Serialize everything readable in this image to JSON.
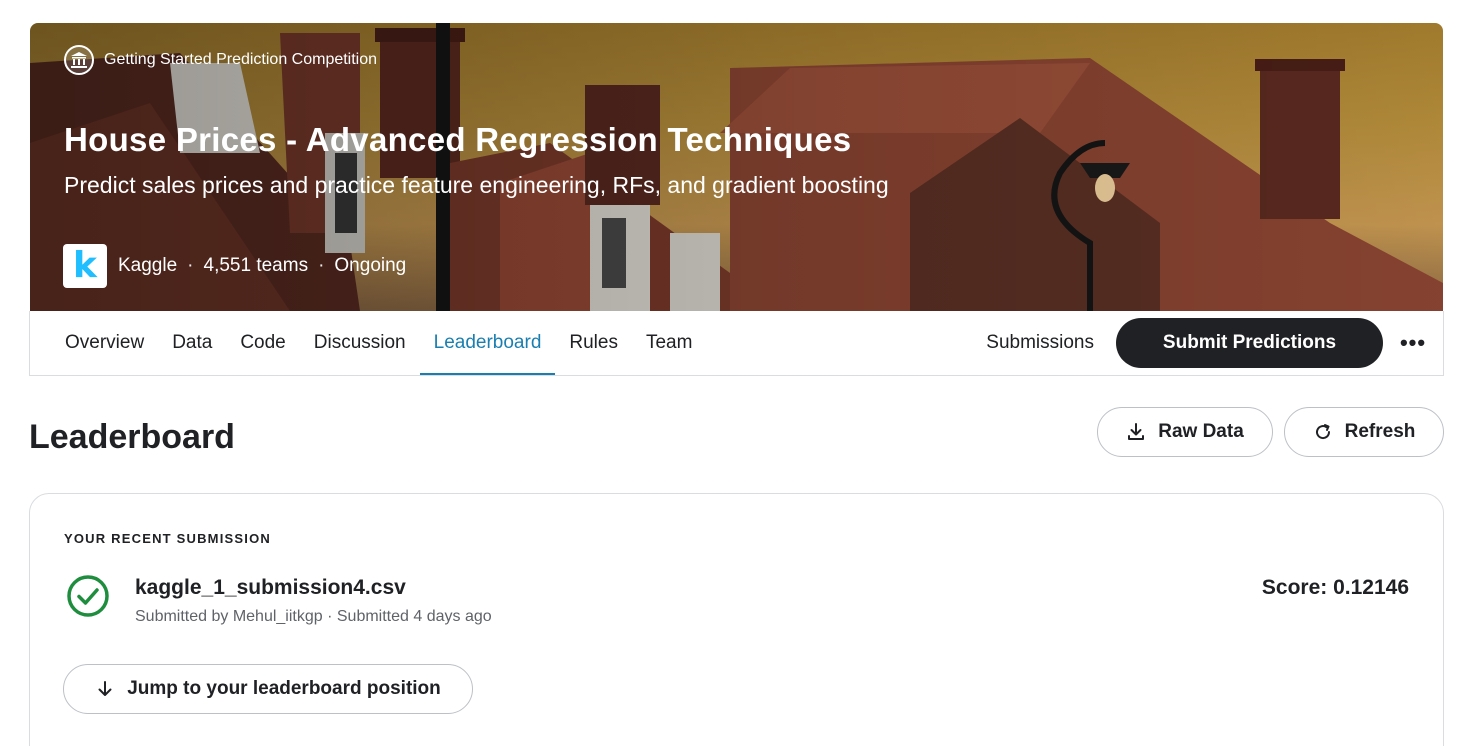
{
  "hero": {
    "competition_type": "Getting Started Prediction Competition",
    "title": "House Prices - Advanced Regression Techniques",
    "subtitle": "Predict sales prices and practice feature engineering, RFs, and gradient boosting",
    "host": "Kaggle",
    "teams": "4,551 teams",
    "status": "Ongoing",
    "logo_letter": "k",
    "badge_icon": "institution-icon"
  },
  "tabs": [
    {
      "label": "Overview"
    },
    {
      "label": "Data"
    },
    {
      "label": "Code"
    },
    {
      "label": "Discussion"
    },
    {
      "label": "Leaderboard",
      "active": true
    },
    {
      "label": "Rules"
    },
    {
      "label": "Team"
    }
  ],
  "tab_actions": {
    "submissions_label": "Submissions",
    "submit_label": "Submit Predictions",
    "more_label": "•••"
  },
  "leaderboard": {
    "title": "Leaderboard",
    "raw_data_label": "Raw Data",
    "refresh_label": "Refresh"
  },
  "recent_submission": {
    "section_label": "YOUR RECENT SUBMISSION",
    "file_name": "kaggle_1_submission4.csv",
    "meta": "Submitted by Mehul_iitkgp · Submitted 4 days ago",
    "score": "Score: 0.12146",
    "jump_label": "Jump to your leaderboard position",
    "status_icon": "check-circle-icon"
  },
  "colors": {
    "accent": "#1a7fb0",
    "success": "#1e8e3e",
    "dark_button": "#202124",
    "kaggle_blue": "#20beff"
  }
}
